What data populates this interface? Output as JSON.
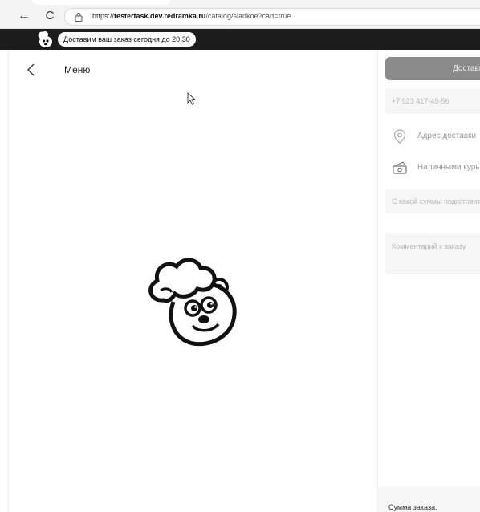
{
  "browser": {
    "back_glyph": "←",
    "reload_glyph": "C",
    "url_scheme": "https://",
    "url_host": "testertask.dev.redramka.ru",
    "url_path": "/catalog/sladkoe?cart=true"
  },
  "banner": {
    "text": "Доставим ваш заказ сегодня до 20:30"
  },
  "header": {
    "menu_label": "Меню"
  },
  "order_panel": {
    "deliver_button": "Доставка",
    "phone_value": "+7 923 417-49-56",
    "address_placeholder": "Адрес доставки",
    "payment_method": "Наличными курьеру",
    "change_placeholder": "С какой суммы подготовить сдачу",
    "comment_placeholder": "Комментарий к заказу",
    "total_label": "Сумма заказа:"
  },
  "icons": {
    "back": "chevron-left-icon",
    "location": "location-pin-icon",
    "cash": "cash-icon",
    "lock": "lock-icon",
    "cursor": "mouse-pointer-icon",
    "logo": "chef-bear-logo"
  },
  "colors": {
    "banner_bg": "#1c1c1c",
    "button_bg": "#8a8a8a",
    "field_bg": "#f6f6f6"
  }
}
